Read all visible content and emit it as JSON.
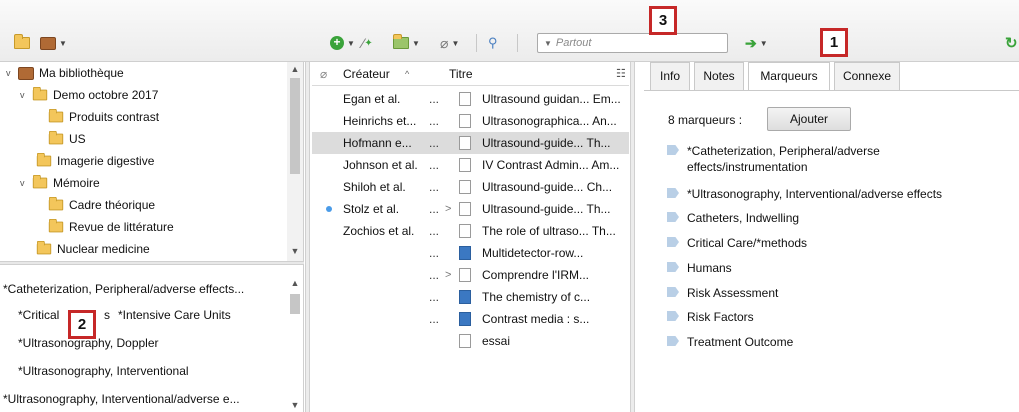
{
  "toolbar": {
    "search_scope": "Partout",
    "icons": [
      "new-collection-icon",
      "new-library-icon",
      "new-item-icon",
      "magic-wand-icon",
      "add-attachment-icon",
      "attach-link-icon",
      "advanced-search-icon",
      "locate-arrow-icon",
      "sync-icon"
    ]
  },
  "callouts": [
    "1",
    "2",
    "3"
  ],
  "collections": [
    {
      "label": "Ma bibliothèque",
      "expanded": "v"
    },
    {
      "label": "Demo octobre 2017",
      "expanded": "v"
    },
    {
      "label": "Produits contrast",
      "expanded": ""
    },
    {
      "label": "US",
      "expanded": ""
    },
    {
      "label": "Imagerie digestive",
      "expanded": ""
    },
    {
      "label": "Mémoire",
      "expanded": "v"
    },
    {
      "label": "Cadre théorique",
      "expanded": ""
    },
    {
      "label": "Revue de littérature",
      "expanded": ""
    },
    {
      "label": "Nuclear medicine",
      "expanded": ""
    }
  ],
  "tag_selector": [
    "*Catheterization, Peripheral/adverse effects...",
    "*Critical",
    "s",
    "*Intensive Care Units",
    "*Ultrasonography, Doppler",
    "*Ultrasonography, Interventional",
    "*Ultrasonography, Interventional/adverse e..."
  ],
  "items_pane": {
    "col_creator": "Créateur",
    "col_title": "Titre",
    "sort_indicator": "^",
    "rows": [
      {
        "creator": "Egan et al.",
        "ell": "...",
        "title": "Ultrasound guidan... Em..."
      },
      {
        "creator": "Heinrichs et...",
        "ell": "...",
        "title": "Ultrasonographica... An..."
      },
      {
        "creator": "Hofmann e...",
        "ell": "...",
        "title": "Ultrasound-guide... Th..."
      },
      {
        "creator": "Johnson et al.",
        "ell": "...",
        "title": "IV Contrast Admin... Am..."
      },
      {
        "creator": "Shiloh et al.",
        "ell": "...",
        "title": "Ultrasound-guide... Ch..."
      },
      {
        "creator": "Stolz et al.",
        "ell": "...",
        "title": "Ultrasound-guide... Th..."
      },
      {
        "creator": "Zochios et al.",
        "ell": "...",
        "title": "The role of ultraso... Th..."
      },
      {
        "creator": "",
        "ell": "...",
        "title": "Multidetector-row..."
      },
      {
        "creator": "",
        "ell": "...",
        "title": "Comprendre l'IRM..."
      },
      {
        "creator": "",
        "ell": "...",
        "title": "The chemistry of c..."
      },
      {
        "creator": "",
        "ell": "...",
        "title": "Contrast media : s..."
      },
      {
        "creator": "",
        "ell": "",
        "title": "essai"
      }
    ]
  },
  "item_pane": {
    "tabs": [
      "Info",
      "Notes",
      "Marqueurs",
      "Connexe"
    ],
    "active_tab": "Marqueurs",
    "count_label": "8 marqueurs :",
    "add_button": "Ajouter",
    "tags": [
      "*Catheterization, Peripheral/adverse effects/instrumentation",
      "*Ultrasonography, Interventional/adverse effects",
      "Catheters, Indwelling",
      "Critical Care/*methods",
      "Humans",
      "Risk Assessment",
      "Risk Factors",
      "Treatment Outcome"
    ]
  },
  "colors": {
    "callout_border": "#c62828",
    "selection": "#dcdcdc",
    "folder": "#f3c65b",
    "green": "#3aa33a"
  }
}
